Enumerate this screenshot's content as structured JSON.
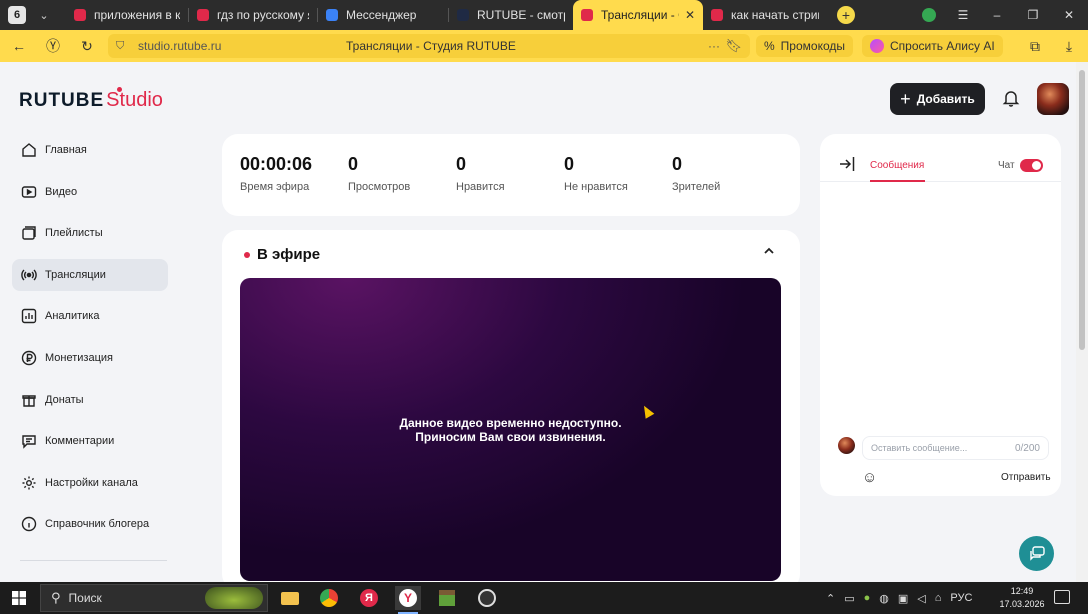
{
  "browser": {
    "tab_count": "6",
    "tabs": [
      {
        "title": "приложения в кото",
        "color": "#e0294a"
      },
      {
        "title": "гдз по русскому яз",
        "color": "#e0294a"
      },
      {
        "title": "Мессенджер",
        "color": "#3b82f6"
      },
      {
        "title": "RUTUBE - смотрите",
        "color": "#1f2a44"
      },
      {
        "title": "Трансляции - Ст",
        "color": "#e0294a"
      },
      {
        "title": "как начать стрим на",
        "color": "#e0294a"
      }
    ],
    "active_tab_index": 4,
    "url": "studio.rutube.ru",
    "page_title": "Трансляции - Студия RUTUBE",
    "promo_label": "Промокоды",
    "alice_label": "Спросить Алису AI"
  },
  "header": {
    "logo_main": "RUTUBE",
    "logo_sub": "Studio",
    "add_button": "Добавить"
  },
  "sidebar": {
    "items": [
      {
        "label": "Главная",
        "icon": "home-icon"
      },
      {
        "label": "Видео",
        "icon": "video-icon"
      },
      {
        "label": "Плейлисты",
        "icon": "playlist-icon"
      },
      {
        "label": "Трансляции",
        "icon": "broadcast-icon",
        "active": true
      },
      {
        "label": "Аналитика",
        "icon": "analytics-icon"
      },
      {
        "label": "Монетизация",
        "icon": "ruble-icon"
      },
      {
        "label": "Донаты",
        "icon": "donate-icon"
      },
      {
        "label": "Комментарии",
        "icon": "comment-icon"
      },
      {
        "label": "Настройки канала",
        "icon": "gear-icon"
      },
      {
        "label": "Справочник блогера",
        "icon": "info-icon"
      }
    ]
  },
  "stats": [
    {
      "value": "00:00:06",
      "label": "Время эфира"
    },
    {
      "value": "0",
      "label": "Просмотров"
    },
    {
      "value": "0",
      "label": "Нравится"
    },
    {
      "value": "0",
      "label": "Не нравится"
    },
    {
      "value": "0",
      "label": "Зрителей"
    }
  ],
  "live": {
    "title": "В эфире",
    "player_message_line1": "Данное видео временно недоступно.",
    "player_message_line2": "Приносим Вам свои извинения."
  },
  "chat": {
    "tab_label": "Сообщения",
    "toggle_label": "Чат",
    "toggle_on": true,
    "input_placeholder": "Оставить сообщение...",
    "char_counter": "0/200",
    "send_label": "Отправить"
  },
  "taskbar": {
    "search_label": "Поиск",
    "language": "РУС",
    "time": "12:49",
    "date": "17.03.2026"
  },
  "colors": {
    "brand_red": "#e0294a",
    "browser_yellow": "#ffdb4d",
    "dark_button": "#1f2024",
    "help_fab": "#1f8f95"
  }
}
